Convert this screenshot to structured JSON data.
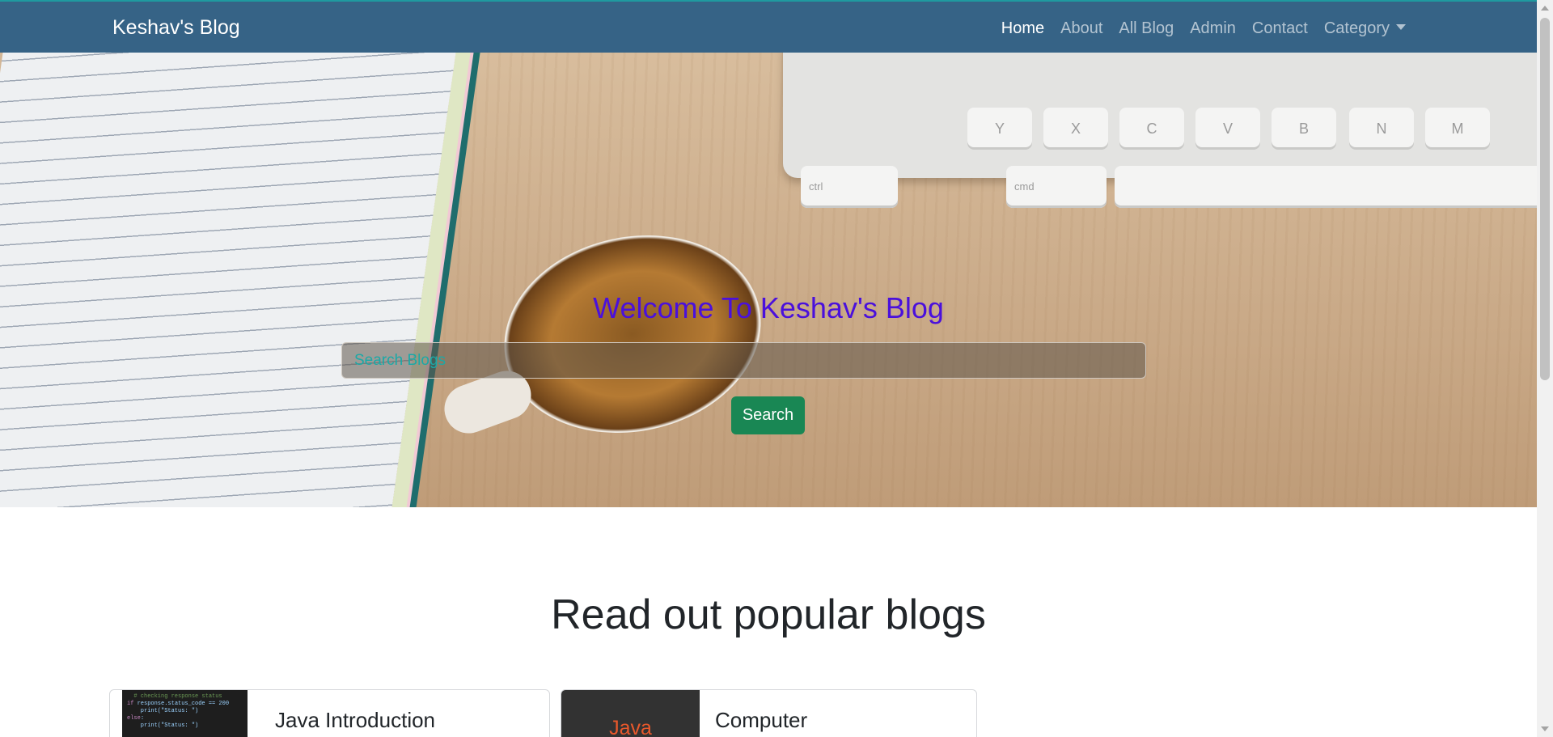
{
  "navbar": {
    "brand": "Keshav's Blog",
    "links": [
      {
        "label": "Home",
        "active": true
      },
      {
        "label": "About"
      },
      {
        "label": "All Blog"
      },
      {
        "label": "Admin"
      },
      {
        "label": "Contact"
      },
      {
        "label": "Category",
        "dropdown": true
      }
    ],
    "bg_color": "#366386"
  },
  "hero": {
    "title": "Welcome To Keshav's Blog",
    "search_placeholder": "Search Blogs",
    "search_value": "",
    "search_button": "Search",
    "keyboard_keys": [
      "Y",
      "X",
      "C",
      "V",
      "B",
      "N",
      "M",
      "ctrl",
      "cmd",
      "⌘"
    ]
  },
  "popular": {
    "heading": "Read out popular blogs",
    "cards": [
      {
        "title": "Java Introduction",
        "thumbnail": "code-screenshot"
      },
      {
        "title": "Computer",
        "thumbnail_label": "Java"
      }
    ]
  },
  "colors": {
    "accent": "#198754",
    "hero_title": "#4a10dc"
  }
}
